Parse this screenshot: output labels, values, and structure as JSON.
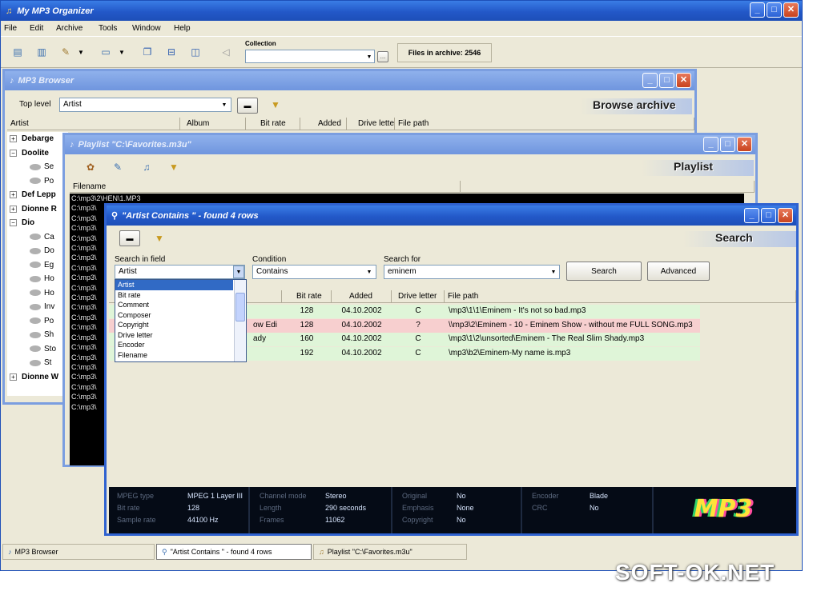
{
  "app": {
    "title": "My MP3 Organizer",
    "menu": [
      "File",
      "Edit",
      "Archive",
      "Tools",
      "Window",
      "Help"
    ],
    "collection_label": "Collection",
    "collection_value": "",
    "files_in_archive": "Files in archive: 2546"
  },
  "browser": {
    "title": "MP3 Browser",
    "top_level_label": "Top level",
    "top_level_value": "Artist",
    "heading": "Browse archive",
    "columns": [
      "Artist",
      "Album",
      "Bit rate",
      "Added",
      "Drive letter",
      "File path"
    ],
    "tree": [
      {
        "label": "Debarge",
        "expanded": false
      },
      {
        "label": "Doolite",
        "expanded": true
      },
      {
        "label": "Se",
        "child": true
      },
      {
        "label": "Po",
        "child": true
      },
      {
        "label": "Def Lepp",
        "expanded": false
      },
      {
        "label": "Dionne R",
        "expanded": false
      },
      {
        "label": "Dio",
        "expanded": true
      },
      {
        "label": "Ca",
        "child": true
      },
      {
        "label": "Do",
        "child": true
      },
      {
        "label": "Eg",
        "child": true
      },
      {
        "label": "Ho",
        "child": true
      },
      {
        "label": "Ho",
        "child": true
      },
      {
        "label": "Inv",
        "child": true
      },
      {
        "label": "Po",
        "child": true
      },
      {
        "label": "Sh",
        "child": true
      },
      {
        "label": "Sto",
        "child": true
      },
      {
        "label": "St",
        "child": true
      },
      {
        "label": "Dionne W",
        "expanded": false
      }
    ]
  },
  "playlist": {
    "title": "Playlist \"C:\\Favorites.m3u\"",
    "heading": "Playlist",
    "column": "Filename",
    "first_file": "C:\\mp3\\2\\HEN\\1.MP3",
    "row_prefix": "C:\\mp3\\",
    "row_count": 22
  },
  "search": {
    "title": "\"Artist Contains \" - found 4 rows",
    "heading": "Search",
    "search_in_field_label": "Search in field",
    "search_in_field_value": "Artist",
    "condition_label": "Condition",
    "condition_value": "Contains",
    "search_for_label": "Search for",
    "search_for_value": "eminem",
    "search_button": "Search",
    "advanced_button": "Advanced",
    "field_options": [
      "Artist",
      "Bit rate",
      "Comment",
      "Composer",
      "Copyright",
      "Drive letter",
      "Encoder",
      "Filename"
    ],
    "selected_option": "Artist",
    "columns": [
      "Bit rate",
      "Added",
      "Drive letter",
      "File path"
    ],
    "rows": [
      {
        "title_tail": "",
        "bitrate": "128",
        "added": "04.10.2002",
        "drive": "C",
        "path": "\\mp3\\1\\1\\Eminem - It's not so bad.mp3",
        "color": "#dff5d8"
      },
      {
        "title_tail": "ow Edit)",
        "bitrate": "128",
        "added": "04.10.2002",
        "drive": "?",
        "path": "\\\\mp3\\2\\Eminem - 10 - Eminem Show - without me FULL SONG.mp3",
        "color": "#f7cfcf"
      },
      {
        "title_tail": "ady",
        "bitrate": "160",
        "added": "04.10.2002",
        "drive": "C",
        "path": "\\mp3\\1\\2\\unsorted\\Eminem - The Real Slim Shady.mp3",
        "color": "#dff5d8"
      },
      {
        "title_tail": "",
        "bitrate": "192",
        "added": "04.10.2002",
        "drive": "C",
        "path": "\\mp3\\b2\\Eminem-My name is.mp3",
        "color": "#dff5d8"
      }
    ],
    "info": [
      {
        "label": "MPEG type",
        "value": "MPEG 1 Layer III"
      },
      {
        "label": "Bit rate",
        "value": "128"
      },
      {
        "label": "Sample rate",
        "value": "44100 Hz"
      },
      {
        "label": "Channel mode",
        "value": "Stereo"
      },
      {
        "label": "Length",
        "value": "290 seconds"
      },
      {
        "label": "Frames",
        "value": "11062"
      },
      {
        "label": "Original",
        "value": "No"
      },
      {
        "label": "Emphasis",
        "value": "None"
      },
      {
        "label": "Copyright",
        "value": "No"
      },
      {
        "label": "Encoder",
        "value": "Blade"
      },
      {
        "label": "CRC",
        "value": "No"
      }
    ],
    "logo": "MP3"
  },
  "taskbar": {
    "items": [
      "MP3 Browser",
      "\"Artist Contains \" - found 4 rows",
      "Playlist \"C:\\Favorites.m3u\""
    ]
  },
  "watermark": "SOFT-OK.NET"
}
